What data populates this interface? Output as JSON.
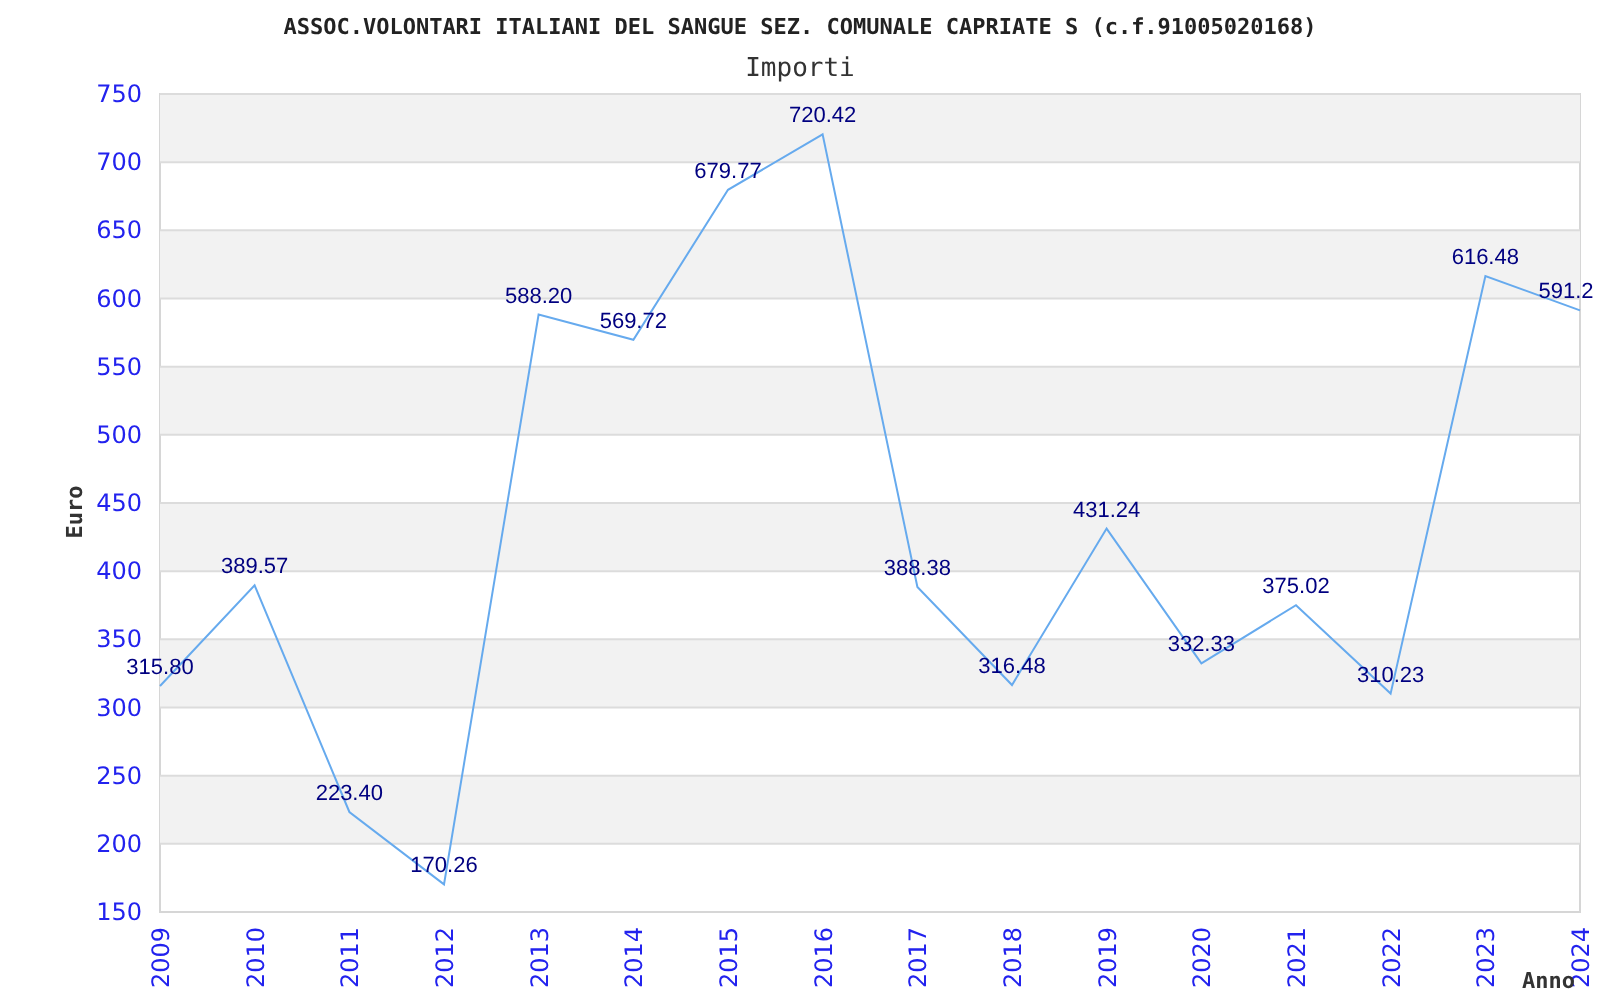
{
  "chart_data": {
    "type": "line",
    "title": "ASSOC.VOLONTARI ITALIANI DEL SANGUE SEZ. COMUNALE CAPRIATE S (c.f.91005020168)",
    "grid": true,
    "xlabel": "Anno",
    "ylabel": "Euro",
    "categories": [
      "2009",
      "2010",
      "2011",
      "2012",
      "2013",
      "2014",
      "2015",
      "2016",
      "2017",
      "2018",
      "2019",
      "2020",
      "2021",
      "2022",
      "2023",
      "2024"
    ],
    "series": [
      {
        "name": "Importi",
        "color": "#66aaee",
        "values": [
          315.8,
          389.57,
          223.4,
          170.26,
          588.2,
          569.72,
          679.77,
          720.42,
          388.38,
          316.48,
          431.24,
          332.33,
          375.02,
          310.23,
          616.48,
          591.2
        ]
      }
    ],
    "value_labels": [
      "315.80",
      "389.57",
      "223.40",
      "170.26",
      "588.20",
      "569.72",
      "679.77",
      "720.42",
      "388.38",
      "316.48",
      "431.24",
      "332.33",
      "375.02",
      "310.23",
      "616.48",
      "591.2"
    ],
    "ylim": [
      150,
      750
    ],
    "yticks": [
      150,
      200,
      250,
      300,
      350,
      400,
      450,
      500,
      550,
      600,
      650,
      700,
      750
    ]
  }
}
